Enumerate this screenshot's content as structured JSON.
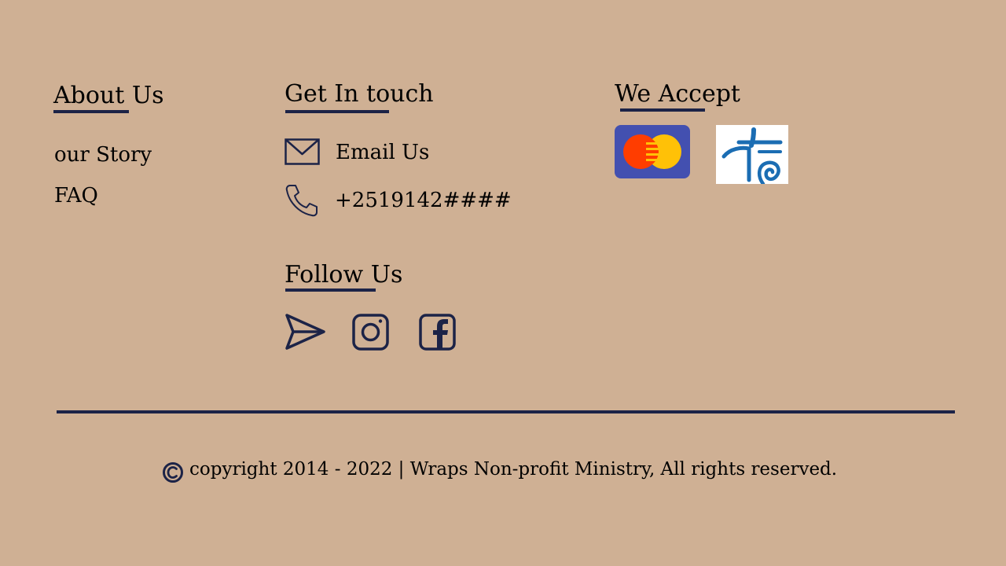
{
  "about": {
    "title": "About Us",
    "links": [
      "our Story",
      "FAQ"
    ]
  },
  "contact": {
    "title": "Get In touch",
    "email_label": "Email Us",
    "phone": "+2519142####",
    "email_icon": "envelope-icon",
    "phone_icon": "phone-icon"
  },
  "follow": {
    "title": "Follow Us",
    "icons": [
      "telegram-icon",
      "instagram-icon",
      "facebook-icon"
    ]
  },
  "accept": {
    "title": "We Accept",
    "methods": [
      "mastercard-logo",
      "telebirr-logo"
    ]
  },
  "footer": {
    "copyright": "copyright 2014 - 2022 | Wraps Non-profit Ministry, All rights reserved.",
    "copyright_icon": "copyright-icon"
  },
  "colors": {
    "background": "#cfb094",
    "accent": "#1c2347",
    "mastercard_bg": "#4350b0",
    "mastercard_red": "#ff3d00",
    "mastercard_yellow": "#ffc107",
    "telebirr_blue": "#1b6db3"
  }
}
